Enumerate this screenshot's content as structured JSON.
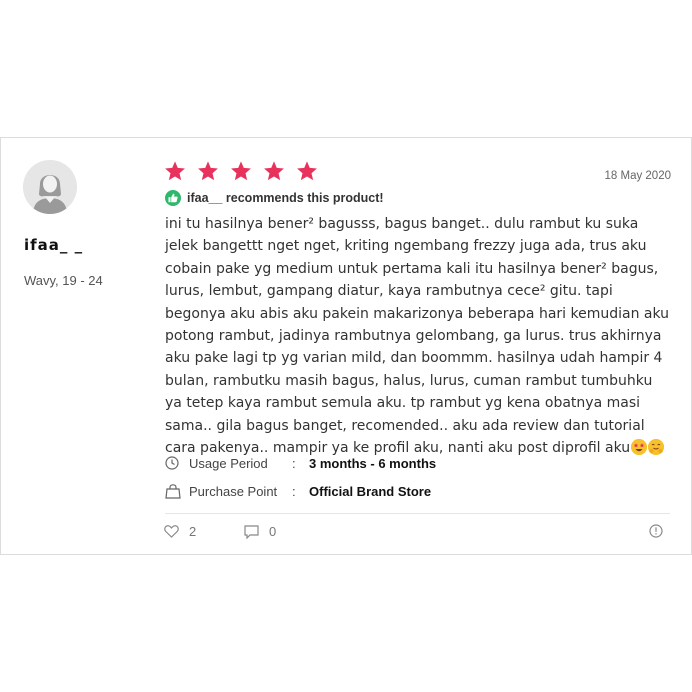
{
  "review": {
    "user": {
      "name": "ifaa_ _",
      "meta": "Wavy, 19 - 24",
      "avatar_icon": "user-avatar-icon"
    },
    "rating": 5,
    "rating_max": 5,
    "star_color": "#e8315b",
    "date": "18 May 2020",
    "recommend_text": "ifaa__ recommends this product!",
    "recommend_color": "#2fb86b",
    "body": "ini tu hasilnya bener² bagusss, bagus banget.. dulu rambut ku suka jelek bangettt nget nget, kriting ngembang frezzy juga ada, trus aku cobain pake yg medium untuk pertama kali itu hasilnya bener² bagus, lurus, lembut, gampang diatur, kaya rambutnya cece² gitu. tapi begonya aku abis aku pakein makarizonya beberapa hari kemudian aku potong rambut, jadinya rambutnya gelombang, ga lurus. trus akhirnya aku pake lagi tp yg varian mild, dan boommm. hasilnya udah hampir 4 bulan, rambutku masih bagus, halus, lurus, cuman rambut tumbuhku ya tetep kaya rambut semula aku. tp rambut yg kena obatnya masi sama.. gila bagus banget, recomended.. aku ada review dan tutorial cara pakenya.. mampir ya ke profil aku, nanti aku post diprofil aku",
    "body_emojis": [
      "star-struck-emoji",
      "hugging-face-emoji"
    ],
    "details": [
      {
        "icon": "clock-icon",
        "label": "Usage Period",
        "colon": ":",
        "value": "3 months - 6 months"
      },
      {
        "icon": "shopping-bag-icon",
        "label": "Purchase Point",
        "colon": ":",
        "value": "Official Brand Store"
      }
    ],
    "likes": "2",
    "comments": "0",
    "report_icon": "alert-circle-icon"
  }
}
